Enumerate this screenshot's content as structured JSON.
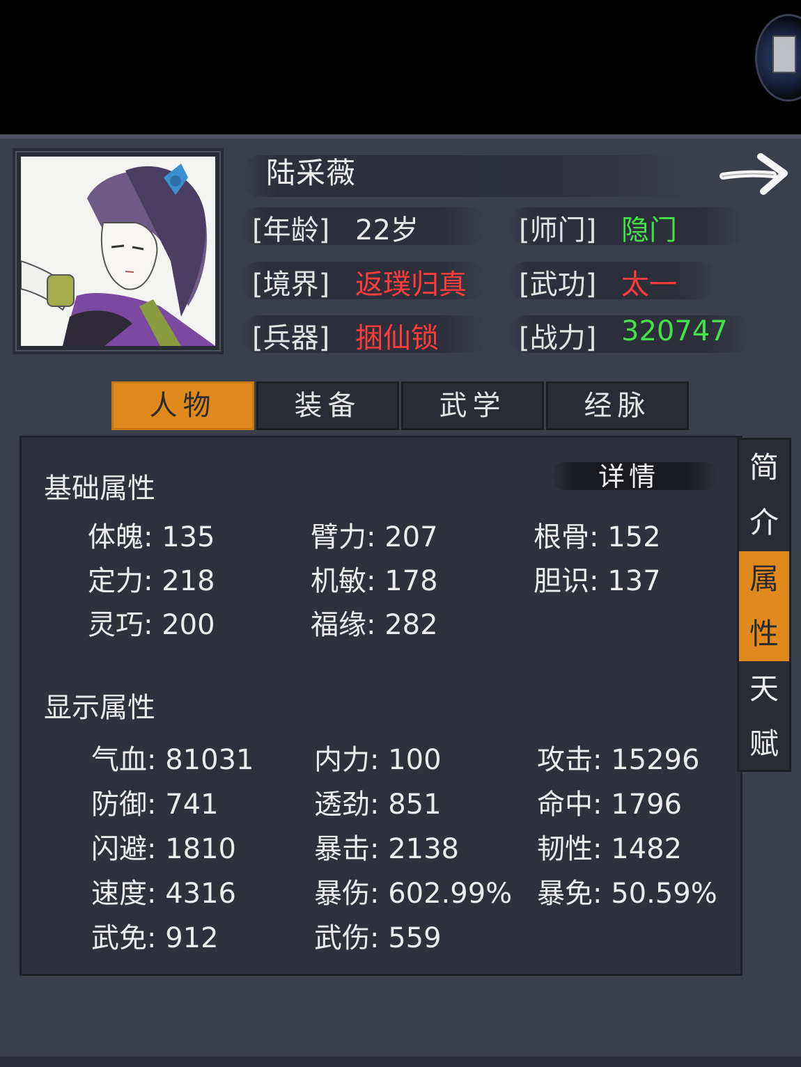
{
  "character": {
    "name": "陆采薇",
    "info": [
      {
        "label": "[年龄]",
        "value": "22岁",
        "color": "#e8e8e8"
      },
      {
        "label": "[师门]",
        "value": "隐门",
        "color": "#45e14a"
      },
      {
        "label": "[境界]",
        "value": "返璞归真",
        "color": "#ff3b3b"
      },
      {
        "label": "[武功]",
        "value": "太一",
        "color": "#ff3b3b"
      },
      {
        "label": "[兵器]",
        "value": "捆仙锁",
        "color": "#ff3b3b"
      },
      {
        "label": "[战力]",
        "value": "320747",
        "color": "#45e14a"
      }
    ]
  },
  "tabs": [
    {
      "label": "人物",
      "active": true
    },
    {
      "label": "装备",
      "active": false
    },
    {
      "label": "武学",
      "active": false
    },
    {
      "label": "经脉",
      "active": false
    }
  ],
  "side_tabs": [
    {
      "chars": [
        "简",
        "介"
      ],
      "active": false
    },
    {
      "chars": [
        "属",
        "性"
      ],
      "active": true
    },
    {
      "chars": [
        "天",
        "赋"
      ],
      "active": false
    }
  ],
  "basic": {
    "title": "基础属性",
    "detail_label": "详情",
    "stats": [
      [
        "体魄: 135",
        "臂力: 207",
        "根骨: 152"
      ],
      [
        "定力: 218",
        "机敏: 178",
        "胆识: 137"
      ],
      [
        "灵巧: 200",
        "福缘: 282",
        ""
      ]
    ]
  },
  "display": {
    "title": "显示属性",
    "stats": [
      [
        "气血: 81031",
        "内力: 100",
        "攻击: 15296"
      ],
      [
        "防御: 741",
        "透劲: 851",
        "命中: 1796"
      ],
      [
        "闪避: 1810",
        "暴击: 2138",
        "韧性: 1482"
      ],
      [
        "速度: 4316",
        "暴伤: 602.99%",
        "暴免: 50.59%"
      ],
      [
        "武免: 912",
        "武伤: 559",
        ""
      ]
    ]
  },
  "colors": {
    "accent": "#e0891c",
    "panel": "#3b3f4c",
    "red": "#ff3b3b",
    "green": "#45e14a"
  }
}
